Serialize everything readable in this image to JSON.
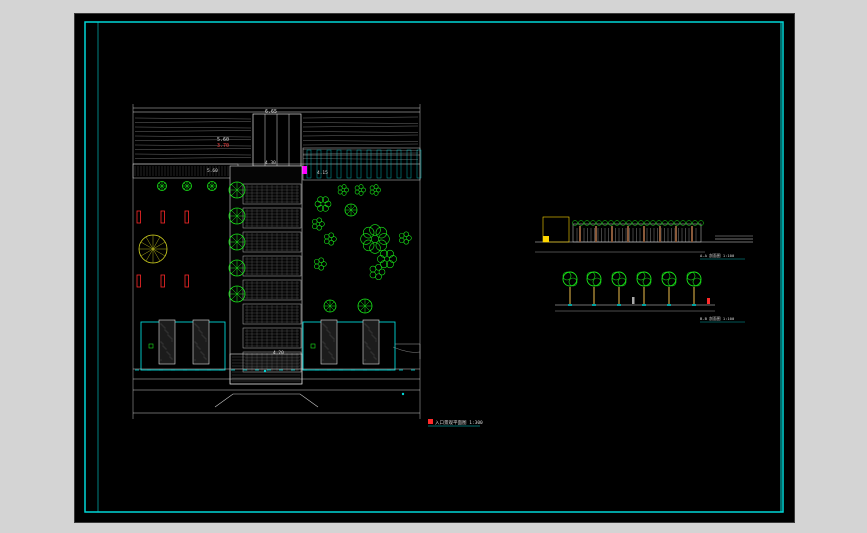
{
  "drawing": {
    "colors": {
      "background": "#000000",
      "frame": "#00d7d7",
      "linework": "#d8d8d8",
      "plants": "#19e619",
      "accent_red": "#ff2a2a",
      "paving": "#8f8f8f"
    },
    "plan": {
      "top_label": "6.65",
      "elev_a": "5.60",
      "elev_b": "3.70",
      "elev_c": "5.60",
      "elev_d": "4.30",
      "elev_e": "4.15",
      "bottom_label": "4.20",
      "caption": "入口景观平面图 1:300"
    },
    "section_1": {
      "caption": "A-A 剖面图 1:100"
    },
    "section_2": {
      "caption": "B-B 剖面图 1:100"
    }
  }
}
